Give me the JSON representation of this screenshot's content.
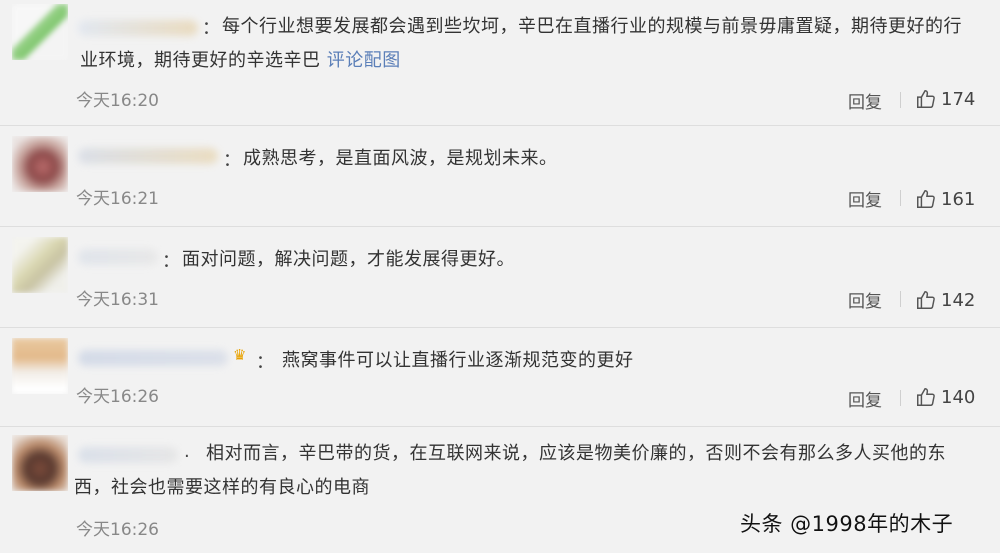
{
  "comments": [
    {
      "text_line1": "每个行业想要发展都会遇到些坎坷，辛巴在直播行业的规模与前景毋庸置疑，期待更好的行",
      "text_line2": "业环境，期待更好的辛选辛巴",
      "link": "评论配图",
      "time": "今天16:20",
      "reply": "回复",
      "likes": "174"
    },
    {
      "text_line1": "成熟思考，是直面风波，是规划未来。",
      "time": "今天16:21",
      "reply": "回复",
      "likes": "161"
    },
    {
      "text_line1": "面对问题，解决问题，才能发展得更好。",
      "time": "今天16:31",
      "reply": "回复",
      "likes": "142"
    },
    {
      "text_line1": "燕窝事件可以让直播行业逐渐规范变的更好",
      "time": "今天16:26",
      "reply": "回复",
      "likes": "140"
    },
    {
      "text_line1": "相对而言，辛巴带的货，在互联网来说，应该是物美价廉的，否则不会有那么多人买他的东",
      "text_line2": "西，社会也需要这样的有良心的电商",
      "time": "今天16:26"
    }
  ],
  "colon": "：",
  "colon_ascii": ":",
  "dot": ".",
  "watermark": "头条 @1998年的木子",
  "icons": {
    "like": "thumbs-up-icon",
    "crown": "crown-icon"
  },
  "colors": {
    "background": "#f2f2f2",
    "link": "#5b7fb8",
    "time": "#888888"
  }
}
